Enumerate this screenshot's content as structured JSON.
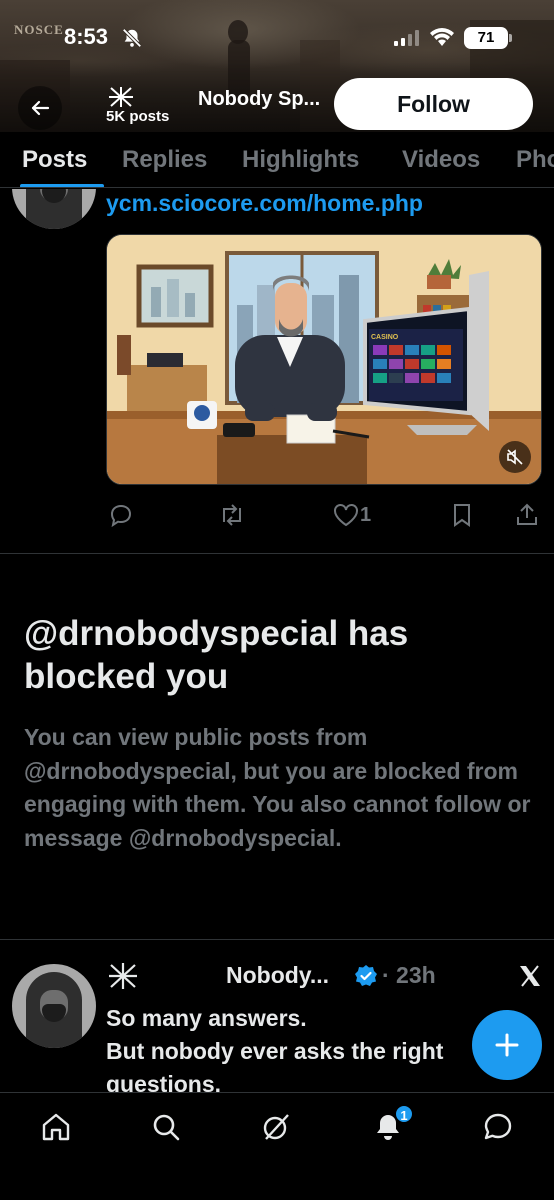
{
  "banner": {
    "text": "NOSCE"
  },
  "status_bar": {
    "time": "8:53",
    "battery": "71"
  },
  "nav": {
    "post_count": "5K posts",
    "name": "Nobody Sp...",
    "follow_label": "Follow"
  },
  "tabs": [
    {
      "label": "Posts",
      "active": true
    },
    {
      "label": "Replies",
      "active": false
    },
    {
      "label": "Highlights",
      "active": false
    },
    {
      "label": "Videos",
      "active": false
    },
    {
      "label": "Pho",
      "active": false
    }
  ],
  "post1": {
    "link": "ycm.sciocore.com/home.php",
    "actions": {
      "replies": "",
      "reposts": "",
      "likes": "1",
      "bookmarks": "",
      "share": ""
    },
    "media": {
      "screen_brand": "CASINO"
    }
  },
  "blocked": {
    "title": "@drnobodyspecial has blocked you",
    "description": "You can view public posts from @drnobodyspecial, but you are blocked from engaging with them. You also cannot follow or message @drnobodyspecial."
  },
  "post2": {
    "name": "Nobody...",
    "time": "· 23h",
    "line1": "So many answers.",
    "line2": "But nobody ever asks the right questions."
  },
  "bottom_nav": {
    "notifications_badge": "1"
  },
  "colors": {
    "accent": "#1d9bf0",
    "background": "#000000",
    "muted": "#71767b",
    "text": "#e7e9ea"
  }
}
